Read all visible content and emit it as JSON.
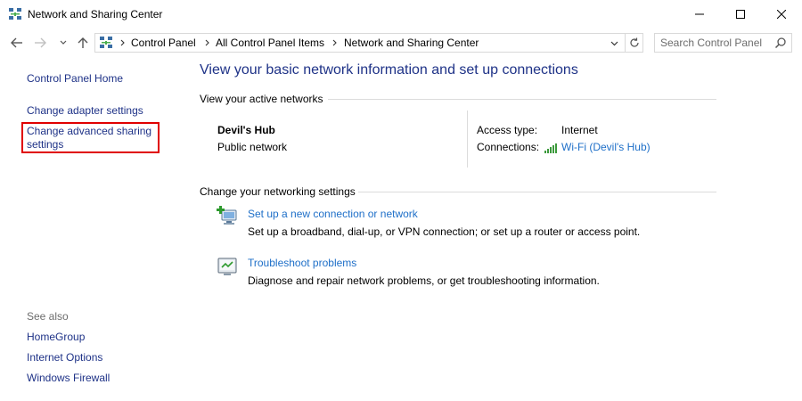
{
  "window": {
    "title": "Network and Sharing Center"
  },
  "address_bar": {
    "crumbs": [
      "Control Panel",
      "All Control Panel Items",
      "Network and Sharing Center"
    ]
  },
  "search": {
    "placeholder": "Search Control Panel"
  },
  "left_pane": {
    "items": [
      {
        "label": "Control Panel Home"
      },
      {
        "label": "Change adapter settings"
      },
      {
        "label": "Change advanced sharing settings"
      }
    ],
    "see_also_label": "See also",
    "see_also": [
      {
        "label": "HomeGroup"
      },
      {
        "label": "Internet Options"
      },
      {
        "label": "Windows Firewall"
      }
    ]
  },
  "main": {
    "heading": "View your basic network information and set up connections",
    "active_networks_label": "View your active networks",
    "network": {
      "name": "Devil's Hub",
      "type": "Public network",
      "access_type_label": "Access type:",
      "access_type_value": "Internet",
      "connections_label": "Connections:",
      "connections_value": "Wi-Fi (Devil's Hub)"
    },
    "change_settings_label": "Change your networking settings",
    "tasks": [
      {
        "title": "Set up a new connection or network",
        "description": "Set up a broadband, dial-up, or VPN connection; or set up a router or access point.",
        "icon": "new-connection-icon"
      },
      {
        "title": "Troubleshoot problems",
        "description": "Diagnose and repair network problems, or get troubleshooting information.",
        "icon": "troubleshoot-icon"
      }
    ]
  },
  "colors": {
    "link": "#1e3287",
    "task_link": "#1e6fc8",
    "highlight": "#e00000"
  }
}
